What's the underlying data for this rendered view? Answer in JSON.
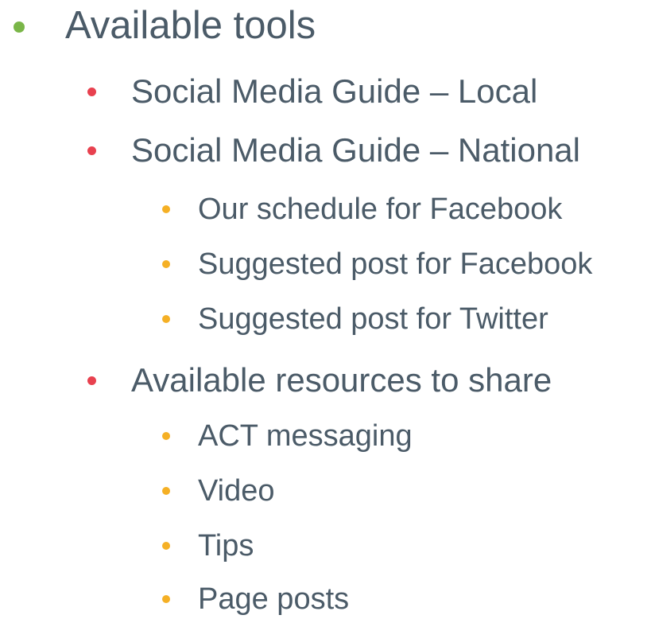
{
  "colors": {
    "text": "#4b5b68",
    "bullet_level1": "#7ab648",
    "bullet_level2": "#e8414f",
    "bullet_level3": "#f5b025"
  },
  "outline": {
    "title": "Available tools",
    "items": [
      "Social Media Guide – Local",
      "Social Media Guide – National",
      "Our schedule for Facebook",
      "Suggested post for Facebook",
      "Suggested post for Twitter",
      "Available resources to share",
      "ACT messaging",
      "Video",
      "Tips",
      "Page posts"
    ]
  }
}
